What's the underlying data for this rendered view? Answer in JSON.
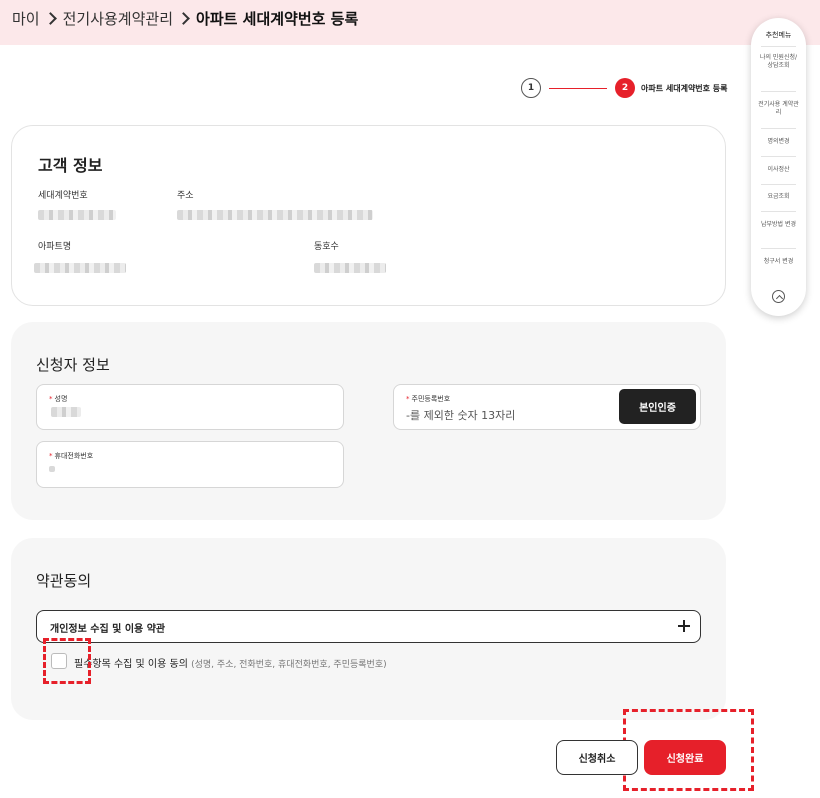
{
  "breadcrumb": {
    "home": "마이",
    "parent": "전기사용계약관리",
    "current": "아파트 세대계약번호 등록"
  },
  "stepper": {
    "step1": "1",
    "step2": "2",
    "step2_label": "아파트 세대계약번호 등록"
  },
  "customer": {
    "title": "고객 정보",
    "contract_no_label": "세대계약번호",
    "address_label": "주소",
    "apartment_label": "아파트명",
    "unit_label": "동호수"
  },
  "applicant": {
    "title": "신청자 정보",
    "name_label": "성명",
    "rrn_label": "주민등록번호",
    "rrn_placeholder": "-를 제외한 숫자 13자리",
    "auth_button": "본인인증",
    "phone_label": "휴대전화번호"
  },
  "terms": {
    "title": "약관동의",
    "accordion_title": "개인정보 수집 및 이용 약관",
    "agree_label": "필수항목 수집 및 이용 동의",
    "agree_detail": "(성명, 주소, 전화번호, 휴대전화번호, 주민등록번호)"
  },
  "buttons": {
    "cancel": "신청취소",
    "submit": "신청완료"
  },
  "float_menu": {
    "title": "추천메뉴",
    "items": [
      "나의 민원신청/ 상담조회",
      "전기사용 계약관리",
      "명의변경",
      "이사정산",
      "요금조회",
      "납부방법 변경",
      "청구서 변경"
    ]
  },
  "colors": {
    "accent": "#e6202a",
    "topbar": "#fce8ea",
    "panel": "#f6f6f6"
  }
}
